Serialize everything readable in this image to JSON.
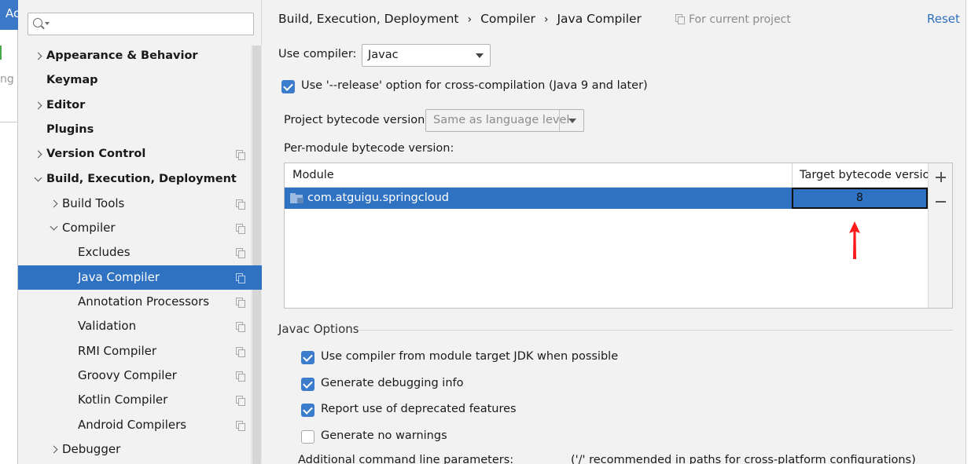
{
  "background": {
    "left_window_title_fragment": "Ac",
    "left_window_text_fragment": "ng"
  },
  "search": {
    "placeholder": ""
  },
  "sidebar": {
    "items": [
      {
        "label": "Appearance & Behavior",
        "expandable": true,
        "expanded": false,
        "bold": true,
        "level": 0,
        "project_icon": false
      },
      {
        "label": "Keymap",
        "expandable": false,
        "bold": true,
        "level": 0,
        "project_icon": false
      },
      {
        "label": "Editor",
        "expandable": true,
        "expanded": false,
        "bold": true,
        "level": 0,
        "project_icon": false
      },
      {
        "label": "Plugins",
        "expandable": false,
        "bold": true,
        "level": 0,
        "project_icon": false
      },
      {
        "label": "Version Control",
        "expandable": true,
        "expanded": false,
        "bold": true,
        "level": 0,
        "project_icon": true
      },
      {
        "label": "Build, Execution, Deployment",
        "expandable": true,
        "expanded": true,
        "bold": true,
        "level": 0,
        "project_icon": false
      },
      {
        "label": "Build Tools",
        "expandable": true,
        "expanded": false,
        "bold": false,
        "level": 1,
        "project_icon": true
      },
      {
        "label": "Compiler",
        "expandable": true,
        "expanded": true,
        "bold": false,
        "level": 1,
        "project_icon": true
      },
      {
        "label": "Excludes",
        "expandable": false,
        "bold": false,
        "level": 2,
        "project_icon": true
      },
      {
        "label": "Java Compiler",
        "expandable": false,
        "bold": false,
        "level": 2,
        "project_icon": true,
        "selected": true
      },
      {
        "label": "Annotation Processors",
        "expandable": false,
        "bold": false,
        "level": 2,
        "project_icon": true
      },
      {
        "label": "Validation",
        "expandable": false,
        "bold": false,
        "level": 2,
        "project_icon": true
      },
      {
        "label": "RMI Compiler",
        "expandable": false,
        "bold": false,
        "level": 2,
        "project_icon": true
      },
      {
        "label": "Groovy Compiler",
        "expandable": false,
        "bold": false,
        "level": 2,
        "project_icon": true
      },
      {
        "label": "Kotlin Compiler",
        "expandable": false,
        "bold": false,
        "level": 2,
        "project_icon": true
      },
      {
        "label": "Android Compilers",
        "expandable": false,
        "bold": false,
        "level": 2,
        "project_icon": true
      },
      {
        "label": "Debugger",
        "expandable": true,
        "expanded": false,
        "bold": false,
        "level": 1,
        "project_icon": false
      }
    ]
  },
  "header": {
    "breadcrumbs": [
      "Build, Execution, Deployment",
      "Compiler",
      "Java Compiler"
    ],
    "separator": "›",
    "scope_label": "For current project",
    "reset_label": "Reset"
  },
  "settings": {
    "use_compiler_label": "Use compiler:",
    "use_compiler_value": "Javac",
    "release_option_label": "Use '--release' option for cross-compilation (Java 9 and later)",
    "release_option_checked": true,
    "project_bytecode_label": "Project bytecode version:",
    "project_bytecode_value": "Same as language level",
    "per_module_label": "Per-module bytecode version:"
  },
  "module_table": {
    "columns": [
      "Module",
      "Target bytecode version"
    ],
    "rows": [
      {
        "module": "com.atguigu.springcloud",
        "target": "8",
        "selected": true
      }
    ]
  },
  "javac_options": {
    "section_title": "Javac Options",
    "checkboxes": [
      {
        "label": "Use compiler from module target JDK when possible",
        "checked": true
      },
      {
        "label": "Generate debugging info",
        "checked": true
      },
      {
        "label": "Report use of deprecated features",
        "checked": true
      },
      {
        "label": "Generate no warnings",
        "checked": false
      }
    ],
    "additional_params_label": "Additional command line parameters:",
    "additional_params_hint": "('/' recommended in paths for cross-platform configurations)"
  },
  "colors": {
    "selection": "#2f72c2",
    "accent_link": "#2e6fc0",
    "checkbox_on": "#3c7ccc",
    "annotation_arrow": "#ff1a1a"
  }
}
